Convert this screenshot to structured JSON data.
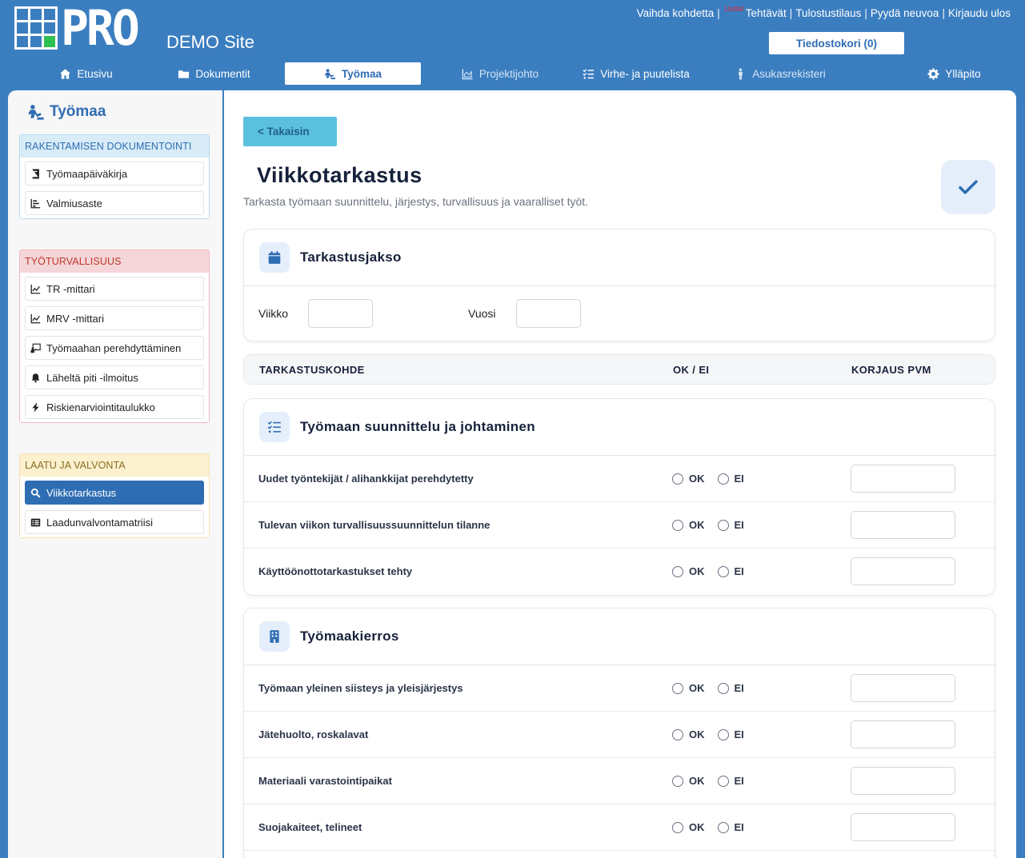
{
  "header": {
    "logo_text": "PRO",
    "site_name": "DEMO Site",
    "top_links": [
      "Vaihda kohdetta",
      "Tehtävät",
      "Tulostustilaus",
      "Pyydä neuvoa",
      "Kirjaudu ulos"
    ],
    "new_badge": "Uutta!",
    "cart_label": "Tiedostokori (0)",
    "brand_color": "#3b7ec0"
  },
  "nav": {
    "items": [
      {
        "label": "Etusivu",
        "icon": "home-icon"
      },
      {
        "label": "Dokumentit",
        "icon": "folder-icon"
      },
      {
        "label": "Työmaa",
        "icon": "worker-icon",
        "active": true
      },
      {
        "label": "Projektijohto",
        "icon": "chart-area-icon"
      },
      {
        "label": "Virhe- ja puutelista",
        "icon": "tasks-icon"
      },
      {
        "label": "Asukasrekisteri",
        "icon": "person-icon"
      },
      {
        "label": "Ylläpito",
        "icon": "gear-icon"
      }
    ]
  },
  "sidebar": {
    "title": "Työmaa",
    "sections": [
      {
        "title": "RAKENTAMISEN DOKUMENTOINTI",
        "items": [
          "Työmaapäiväkirja",
          "Valmiusaste"
        ]
      },
      {
        "title": "TYÖTURVALLISUUS",
        "items": [
          "TR -mittari",
          "MRV -mittari",
          "Työmaahan perehdyttäminen",
          "Läheltä piti -ilmoitus",
          "Riskienarviointitaulukko"
        ]
      },
      {
        "title": "LAATU JA VALVONTA",
        "items": [
          "Viikkotarkastus",
          "Laadunvalvontamatriisi"
        ]
      }
    ]
  },
  "main": {
    "back_label": "< Takaisin",
    "title": "Viikkotarkastus",
    "subtitle": "Tarkasta työmaan suunnittelu, järjestys, turvallisuus ja vaaralliset työt.",
    "period": {
      "title": "Tarkastusjakso",
      "week_label": "Viikko",
      "week_value": "",
      "year_label": "Vuosi",
      "year_value": ""
    },
    "columns": [
      "TARKASTUSKOHDE",
      "OK / EI",
      "KORJAUS PVM"
    ],
    "ok_label": "OK",
    "ei_label": "EI",
    "sections": [
      {
        "title": "Työmaan suunnittelu ja johtaminen",
        "rows": [
          "Uudet työntekijät / alihankkijat perehdytetty",
          "Tulevan viikon turvallisuussuunnittelun tilanne",
          "Käyttöönottotarkastukset tehty"
        ]
      },
      {
        "title": "Työmaakierros",
        "rows": [
          "Työmaan yleinen siisteys ja yleisjärjestys",
          "Jätehuolto, roskalavat",
          "Materiaali varastointipaikat",
          "Suojakaiteet, telineet"
        ]
      }
    ]
  }
}
